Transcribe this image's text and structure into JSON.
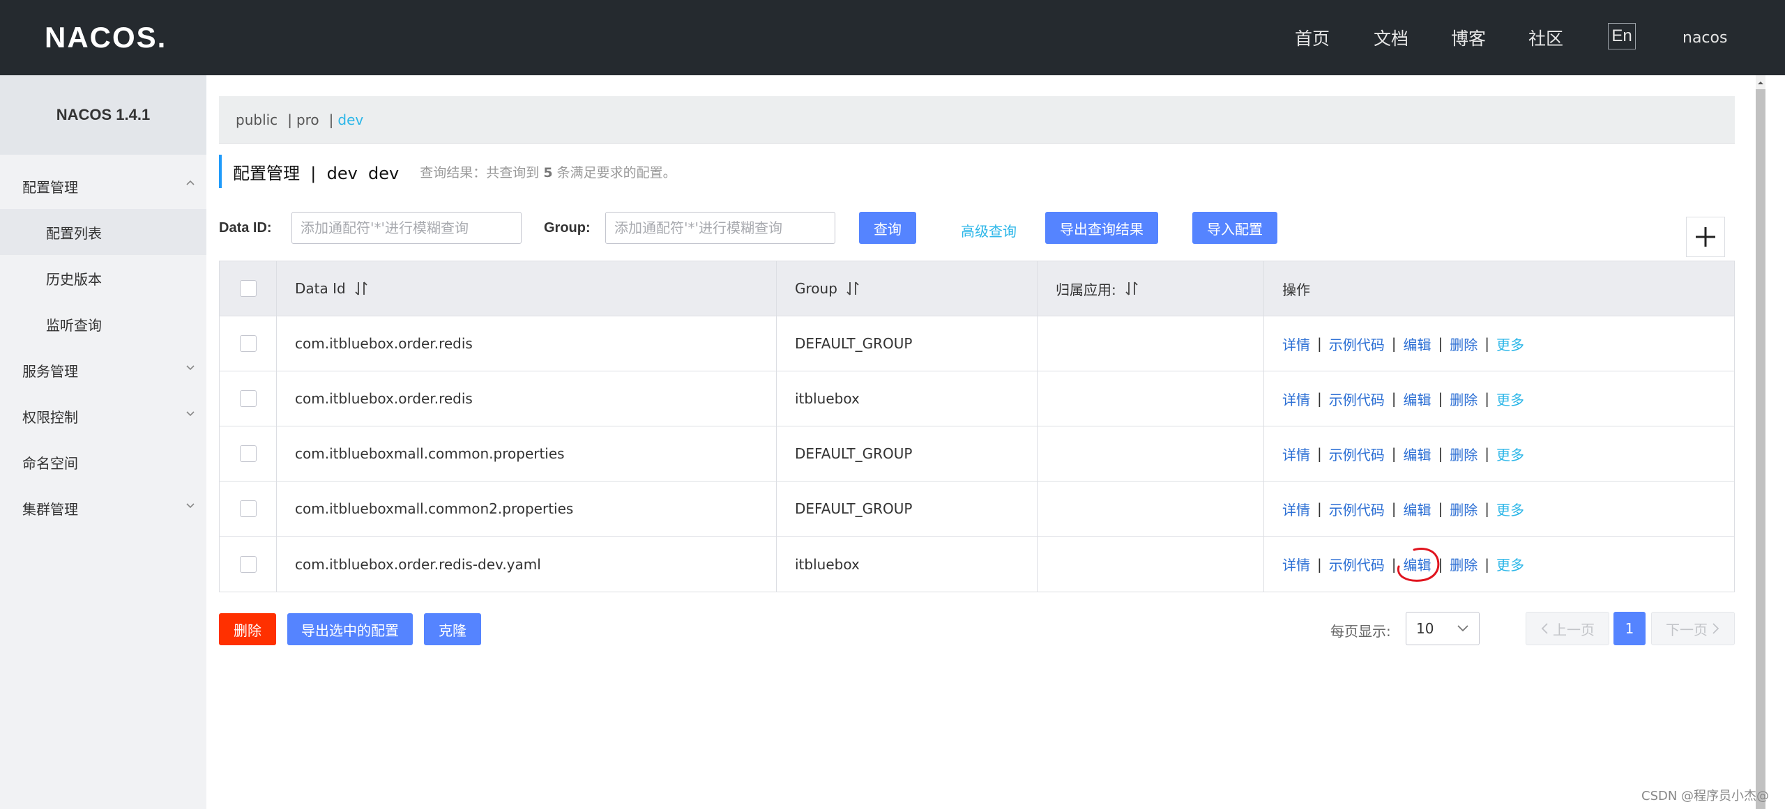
{
  "header": {
    "logo": "NACOS.",
    "nav": [
      "首页",
      "文档",
      "博客",
      "社区"
    ],
    "lang": "En",
    "user": "nacos"
  },
  "sidebar": {
    "version": "NACOS 1.4.1",
    "items": [
      {
        "label": "配置管理"
      },
      {
        "label": "配置列表"
      },
      {
        "label": "历史版本"
      },
      {
        "label": "监听查询"
      },
      {
        "label": "服务管理"
      },
      {
        "label": "权限控制"
      },
      {
        "label": "命名空间"
      },
      {
        "label": "集群管理"
      }
    ]
  },
  "namespaces": [
    "public",
    "pro",
    "dev"
  ],
  "namespace_separator": "|",
  "page": {
    "title": "配置管理  |  dev  dev",
    "result_prefix": "查询结果：共查询到",
    "result_count": "5",
    "result_suffix": "条满足要求的配置。"
  },
  "search": {
    "dataid_label": "Data ID:",
    "dataid_placeholder": "添加通配符'*'进行模糊查询",
    "group_label": "Group:",
    "group_placeholder": "添加通配符'*'进行模糊查询",
    "query": "查询",
    "advanced": "高级查询",
    "export": "导出查询结果",
    "import": "导入配置"
  },
  "table": {
    "headers": [
      "Data Id",
      "Group",
      "归属应用:",
      "操作"
    ],
    "rows": [
      {
        "data_id": "com.itbluebox.order.redis",
        "group": "DEFAULT_GROUP",
        "app": ""
      },
      {
        "data_id": "com.itbluebox.order.redis",
        "group": "itbluebox",
        "app": ""
      },
      {
        "data_id": "com.itblueboxmall.common.properties",
        "group": "DEFAULT_GROUP",
        "app": ""
      },
      {
        "data_id": "com.itblueboxmall.common2.properties",
        "group": "DEFAULT_GROUP",
        "app": ""
      },
      {
        "data_id": "com.itbluebox.order.redis-dev.yaml",
        "group": "itbluebox",
        "app": ""
      }
    ],
    "ops": [
      "详情",
      "示例代码",
      "编辑",
      "删除",
      "更多"
    ],
    "op_separator": "|"
  },
  "bottom": {
    "delete": "删除",
    "export_selected": "导出选中的配置",
    "clone": "克隆"
  },
  "pagination": {
    "page_size_label": "每页显示:",
    "page_size": "10",
    "prev": "上一页",
    "current": "1",
    "next": "下一页"
  },
  "watermark": "CSDN @程序员小杰@",
  "colors": {
    "header_bg": "#252a2f",
    "primary": "#5584ff",
    "danger": "#ff3000",
    "link": "#2c6fd4",
    "accent": "#2bb6e8"
  }
}
